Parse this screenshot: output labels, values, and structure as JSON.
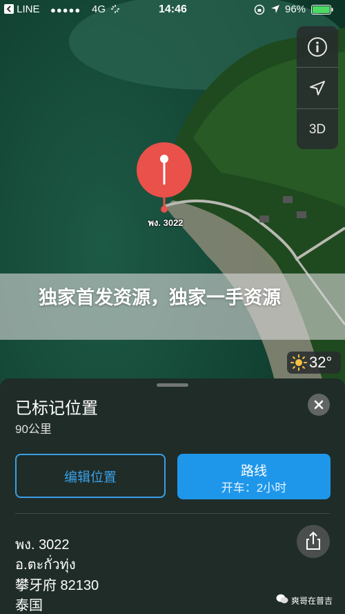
{
  "status_bar": {
    "carrier": "LINE",
    "signal": "●●●●●",
    "network": "4G",
    "time": "14:46",
    "battery": "96%"
  },
  "map": {
    "pin_label": "พง. 3022",
    "controls": {
      "info_icon": "info-icon",
      "location_icon": "location-arrow-icon",
      "mode_label": "3D"
    },
    "weather": {
      "icon": "sun-icon",
      "temperature": "32°"
    }
  },
  "banner": {
    "text": "独家首发资源，独家一手资源"
  },
  "sheet": {
    "title": "已标记位置",
    "distance": "90公里",
    "close_icon": "close-icon",
    "edit_label": "编辑位置",
    "route_label": "路线",
    "route_sub": "开车：2小时",
    "address_lines": [
      "พง. 3022",
      "อ.ตะกั่วทุ่ง",
      "攀牙府 82130",
      "泰国"
    ],
    "share_icon": "share-icon"
  },
  "watermark": {
    "text": "爽哥在普吉"
  },
  "colors": {
    "accent": "#1e97ea",
    "pin": "#e9514a",
    "sheet_bg": "#1f2c28"
  }
}
